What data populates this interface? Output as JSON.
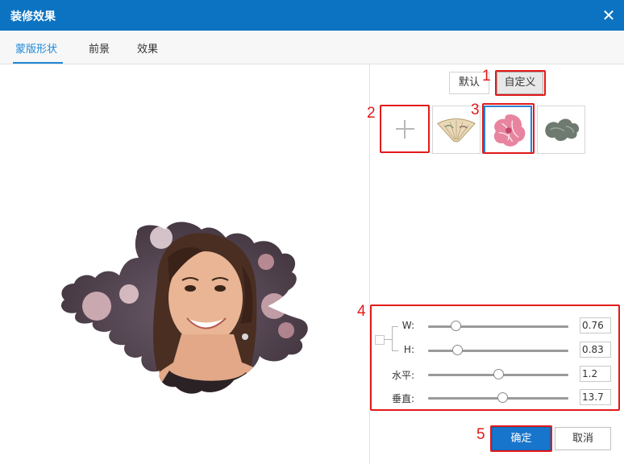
{
  "window": {
    "title": "装修效果"
  },
  "tabs": [
    {
      "label": "蒙版形状",
      "active": true
    },
    {
      "label": "前景",
      "active": false
    },
    {
      "label": "效果",
      "active": false
    }
  ],
  "mode": {
    "default_label": "默认",
    "custom_label": "自定义",
    "selected": "自定义"
  },
  "thumbnails": [
    {
      "name": "add-custom-shape",
      "icon": "plus-icon"
    },
    {
      "name": "shape-folding-fan"
    },
    {
      "name": "shape-pink-flower",
      "selected": true
    },
    {
      "name": "shape-ink-blot"
    }
  ],
  "sliders": [
    {
      "label": "W:",
      "value": "0.76",
      "fraction": 0.2
    },
    {
      "label": "H:",
      "value": "0.83",
      "fraction": 0.21
    },
    {
      "label": "水平:",
      "value": "1.2",
      "fraction": 0.5
    },
    {
      "label": "垂直:",
      "value": "13.7",
      "fraction": 0.53
    }
  ],
  "buttons": {
    "ok": "确定",
    "cancel": "取消"
  },
  "annotations": [
    "1",
    "2",
    "3",
    "4",
    "5"
  ],
  "colors": {
    "accent": "#0c73c2",
    "tab_active": "#1e88d6",
    "annotation": "#e21a1a",
    "ok_button": "#1775cc"
  }
}
